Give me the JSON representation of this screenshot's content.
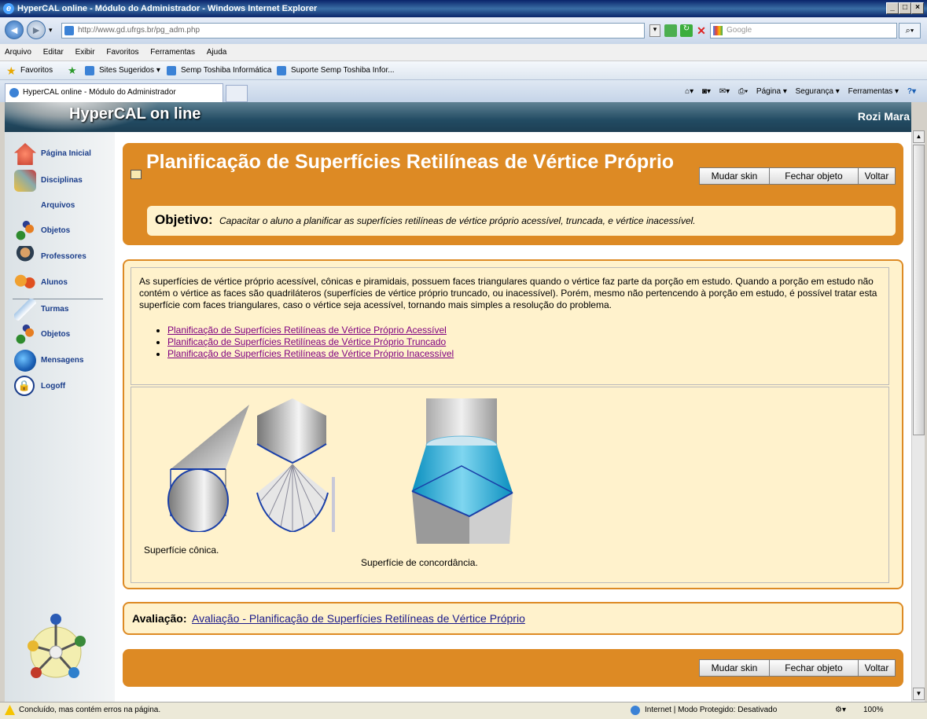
{
  "window": {
    "title": "HyperCAL online - Módulo do Administrador - Windows Internet Explorer"
  },
  "browser": {
    "address": "http://www.gd.ufrgs.br/pg_adm.php",
    "search_placeholder": "Google",
    "menu": [
      "Arquivo",
      "Editar",
      "Exibir",
      "Favoritos",
      "Ferramentas",
      "Ajuda"
    ],
    "favorites_label": "Favoritos",
    "favorites_links": [
      "Sites Sugeridos ▾",
      "Semp Toshiba Informática",
      "Suporte Semp Toshiba Infor..."
    ],
    "tab_title": "HyperCAL online - Módulo do Administrador",
    "command_bar": [
      "Página ▾",
      "Segurança ▾",
      "Ferramentas ▾"
    ]
  },
  "site": {
    "logo": "HyperCAL on line",
    "user": "Rozi Mara"
  },
  "sidebar": {
    "items": [
      {
        "label": "Página Inicial",
        "icon": "house-icon"
      },
      {
        "label": "Disciplinas",
        "icon": "tools-icon"
      },
      {
        "label": "Arquivos",
        "icon": ""
      },
      {
        "label": "Objetos",
        "icon": "molecule-icon"
      },
      {
        "label": "Professores",
        "icon": "graduate-icon"
      },
      {
        "label": "Alunos",
        "icon": "students-icon"
      },
      {
        "label": "Turmas",
        "icon": "book-icon"
      },
      {
        "label": "Objetos",
        "icon": "molecule-icon"
      },
      {
        "label": "Mensagens",
        "icon": "globe-mail-icon"
      },
      {
        "label": "Logoff",
        "icon": "lock-icon"
      }
    ]
  },
  "header_panel": {
    "title": "Planificação de Superfícies Retilíneas de Vértice Próprio",
    "buttons": [
      "Mudar skin",
      "Fechar objeto",
      "Voltar"
    ],
    "objective_label": "Objetivo:",
    "objective_text": "Capacitar o aluno a planificar as superfícies retilíneas de vértice próprio acessível, truncada, e vértice inacessível."
  },
  "main_panel": {
    "paragraph": "As superfícies de vértice próprio acessível, cônicas e piramidais, possuem faces triangulares quando o vértice faz parte da porção em estudo. Quando a porção em estudo não contém o vértice as faces são quadriláteros (superfícies de vértice próprio truncado, ou inacessível). Porém, mesmo não pertencendo à porção em estudo, é possível tratar esta superfície com faces triangulares, caso o vértice seja acessível, tornando mais simples a resolução do problema.",
    "links": [
      "Planificação de Superfícies Retilíneas de Vértice Próprio Acessível",
      "Planificação de Superfícies Retilíneas de Vértice Próprio Truncado",
      "Planificação de Superfícies Retilíneas de Vértice Próprio Inacessível"
    ],
    "captions": [
      "Superfície cônica.",
      "Superfície de concordância."
    ]
  },
  "evaluation": {
    "label": "Avaliação:",
    "link": "Avaliação - Planificação de Superfícies Retilíneas de Vértice Próprio"
  },
  "footer_panel": {
    "buttons": [
      "Mudar skin",
      "Fechar objeto",
      "Voltar"
    ]
  },
  "status": {
    "message": "Concluído, mas contém erros na página.",
    "zone": "Internet | Modo Protegido: Desativado",
    "zoom": "100%"
  },
  "colors": {
    "accent": "#dd8a24",
    "panel_bg": "#fff2cc",
    "header_bg": "#224b63",
    "link": "#800080"
  }
}
